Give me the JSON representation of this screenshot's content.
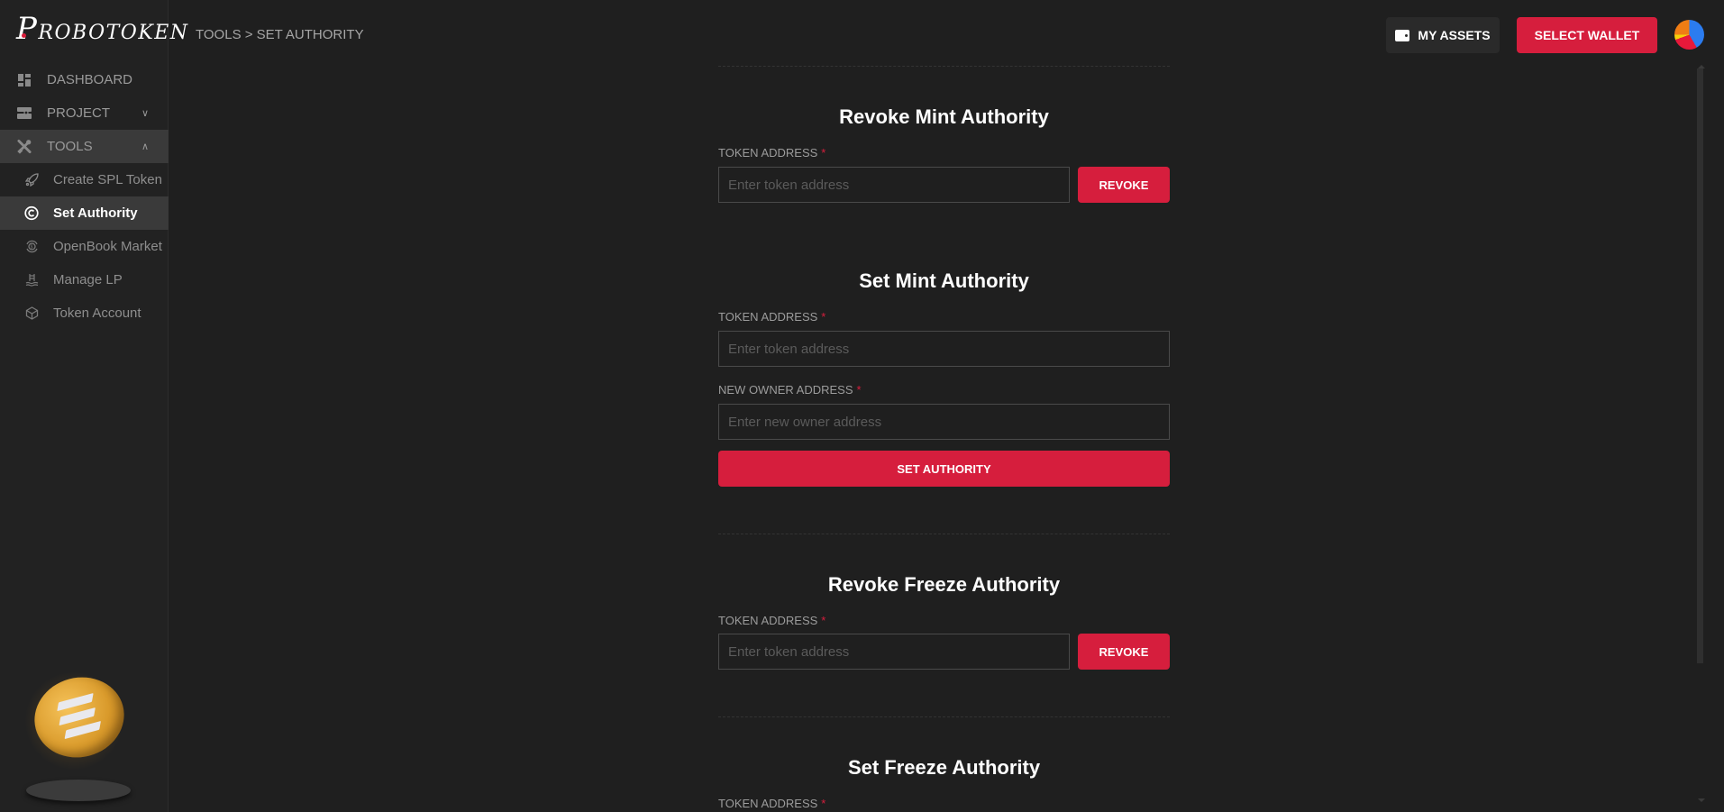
{
  "app": {
    "logo_text": "ROBOTOKEN",
    "logo_initial": "P"
  },
  "sidebar": {
    "items": [
      {
        "label": "DASHBOARD",
        "icon": "dashboard-icon"
      },
      {
        "label": "PROJECT",
        "icon": "project-icon",
        "expandable": true,
        "expanded": false
      },
      {
        "label": "TOOLS",
        "icon": "tools-icon",
        "expandable": true,
        "expanded": true
      }
    ],
    "tools_subitems": [
      {
        "label": "Create SPL Token",
        "icon": "rocket-icon",
        "active": false
      },
      {
        "label": "Set Authority",
        "icon": "copyright-icon",
        "active": true
      },
      {
        "label": "OpenBook Market",
        "icon": "market-icon",
        "active": false
      },
      {
        "label": "Manage LP",
        "icon": "pool-icon",
        "active": false
      },
      {
        "label": "Token Account",
        "icon": "cube-icon",
        "active": false
      }
    ]
  },
  "header": {
    "breadcrumb": "TOOLS > SET AUTHORITY",
    "my_assets_label": "MY ASSETS",
    "select_wallet_label": "SELECT WALLET"
  },
  "sections": {
    "revoke_mint": {
      "title": "Revoke Mint Authority",
      "token_label": "TOKEN ADDRESS",
      "token_placeholder": "Enter token address",
      "token_value": "",
      "button_label": "REVOKE"
    },
    "set_mint": {
      "title": "Set Mint Authority",
      "token_label": "TOKEN ADDRESS",
      "token_placeholder": "Enter token address",
      "token_value": "",
      "owner_label": "NEW OWNER ADDRESS",
      "owner_placeholder": "Enter new owner address",
      "owner_value": "",
      "button_label": "SET AUTHORITY"
    },
    "revoke_freeze": {
      "title": "Revoke Freeze Authority",
      "token_label": "TOKEN ADDRESS",
      "token_placeholder": "Enter token address",
      "token_value": "",
      "button_label": "REVOKE"
    },
    "set_freeze": {
      "title": "Set Freeze Authority",
      "token_label": "TOKEN ADDRESS"
    }
  },
  "required_marker": "*",
  "colors": {
    "accent": "#d61e3d",
    "background": "#1f1f1f",
    "sidebar": "#222222",
    "active_item": "#3a3a3a"
  }
}
